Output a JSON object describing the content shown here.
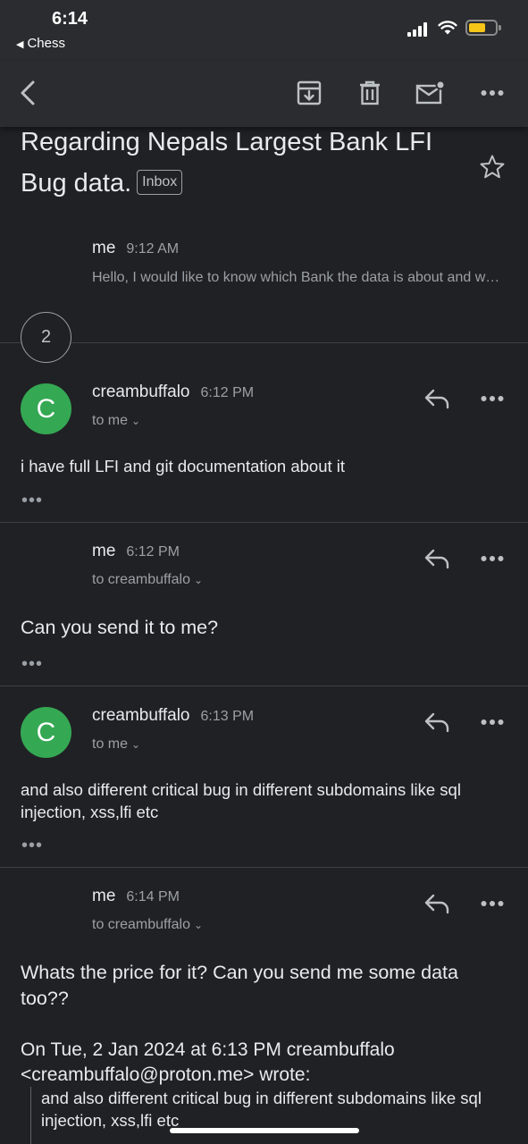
{
  "status_bar": {
    "time": "6:14",
    "back_app": "Chess",
    "battery_color": "#f5c518"
  },
  "toolbar": {
    "icons": [
      "back-arrow-icon",
      "archive-icon",
      "trash-icon",
      "mark-unread-icon",
      "more-icon"
    ]
  },
  "thread": {
    "subject": "Regarding Nepals Largest Bank LFI Bug data.",
    "label": "Inbox",
    "collapsed_count": "2"
  },
  "messages": [
    {
      "sender": "me",
      "time": "9:12 AM",
      "snippet": "Hello, I would like to know which Bank the data is about and what is the price for it."
    },
    {
      "sender": "creambuffalo",
      "avatar": "C",
      "time": "6:12 PM",
      "recipient": "to me",
      "body": "i have full LFI and git documentation about it"
    },
    {
      "sender": "me",
      "time": "6:12 PM",
      "recipient": "to creambuffalo",
      "body": "Can you send it to me?"
    },
    {
      "sender": "creambuffalo",
      "avatar": "C",
      "time": "6:13 PM",
      "recipient": "to me",
      "body": "and also different critical bug in different subdomains like sql injection, xss,lfi etc"
    },
    {
      "sender": "me",
      "time": "6:14 PM",
      "recipient": "to creambuffalo",
      "body": "Whats the price for it? Can you send me some data too??",
      "quote_header": "On Tue, 2 Jan 2024 at 6:13 PM creambuffalo <creambuffalo@proton.me> wrote:",
      "quote": "and also different critical bug in different subdomains like sql injection, xss,lfi etc"
    }
  ],
  "more_glyph": "•••",
  "colors": {
    "background": "#202124",
    "avatar": "#34a853",
    "toolbar": "#2b2c2f"
  }
}
